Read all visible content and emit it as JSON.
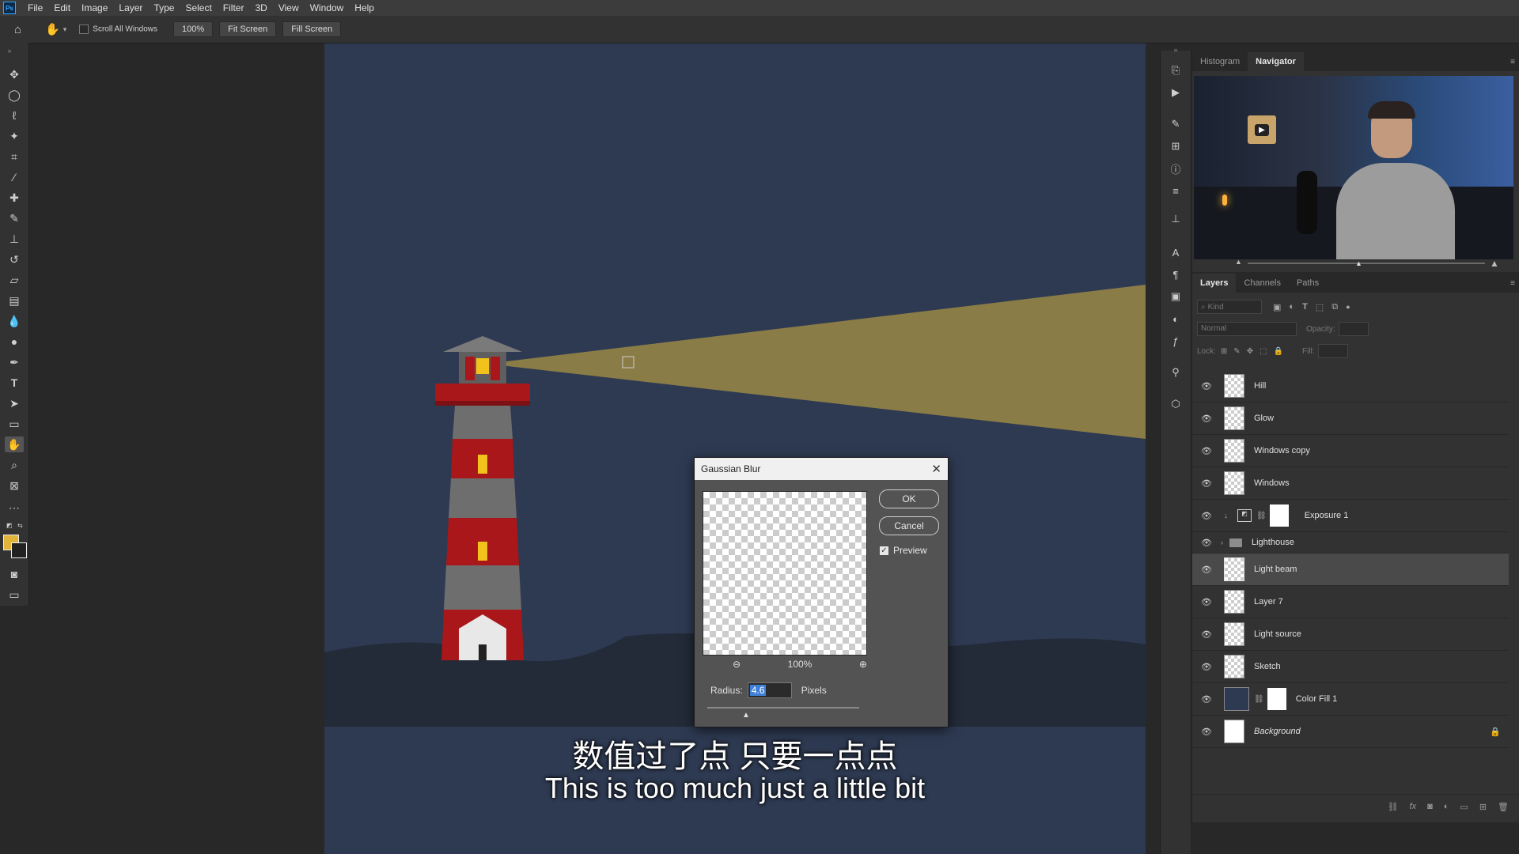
{
  "app": {
    "logo": "Ps"
  },
  "menu": [
    "File",
    "Edit",
    "Image",
    "Layer",
    "Type",
    "Select",
    "Filter",
    "3D",
    "View",
    "Window",
    "Help"
  ],
  "options": {
    "scroll_all_windows": "Scroll All Windows",
    "zoom": "100%",
    "fit_screen": "Fit Screen",
    "fill_screen": "Fill Screen"
  },
  "top_panel": {
    "tabs": [
      "Histogram",
      "Navigator"
    ],
    "active": "Navigator"
  },
  "layers_panel": {
    "tabs": [
      "Layers",
      "Channels",
      "Paths"
    ],
    "filter_placeholder": "Kind",
    "blend_mode": "Normal",
    "opacity_label": "Opacity:",
    "lock_label": "Lock:",
    "fill_label": "Fill:",
    "layers": [
      {
        "name": "Hill"
      },
      {
        "name": "Glow"
      },
      {
        "name": "Windows copy"
      },
      {
        "name": "Windows"
      },
      {
        "name": "Exposure 1"
      },
      {
        "name": "Lighthouse"
      },
      {
        "name": "Light beam",
        "selected": true
      },
      {
        "name": "Layer 7"
      },
      {
        "name": "Light source"
      },
      {
        "name": "Sketch"
      },
      {
        "name": "Color Fill 1"
      },
      {
        "name": "Background"
      }
    ]
  },
  "dialog": {
    "title": "Gaussian Blur",
    "ok": "OK",
    "cancel": "Cancel",
    "preview_label": "Preview",
    "preview_checked": true,
    "zoom": "100%",
    "radius_label": "Radius:",
    "radius_value": "4.6",
    "unit": "Pixels"
  },
  "subtitles": {
    "zh": "数值过了点 只要一点点",
    "en": "This is too much just a little bit"
  },
  "colors": {
    "canvas_bg": "#2e3a52",
    "beam": "#8f8046",
    "lighthouse_red": "#a9171a",
    "lighthouse_white": "#6e6e6e",
    "window": "#f2c21c"
  }
}
